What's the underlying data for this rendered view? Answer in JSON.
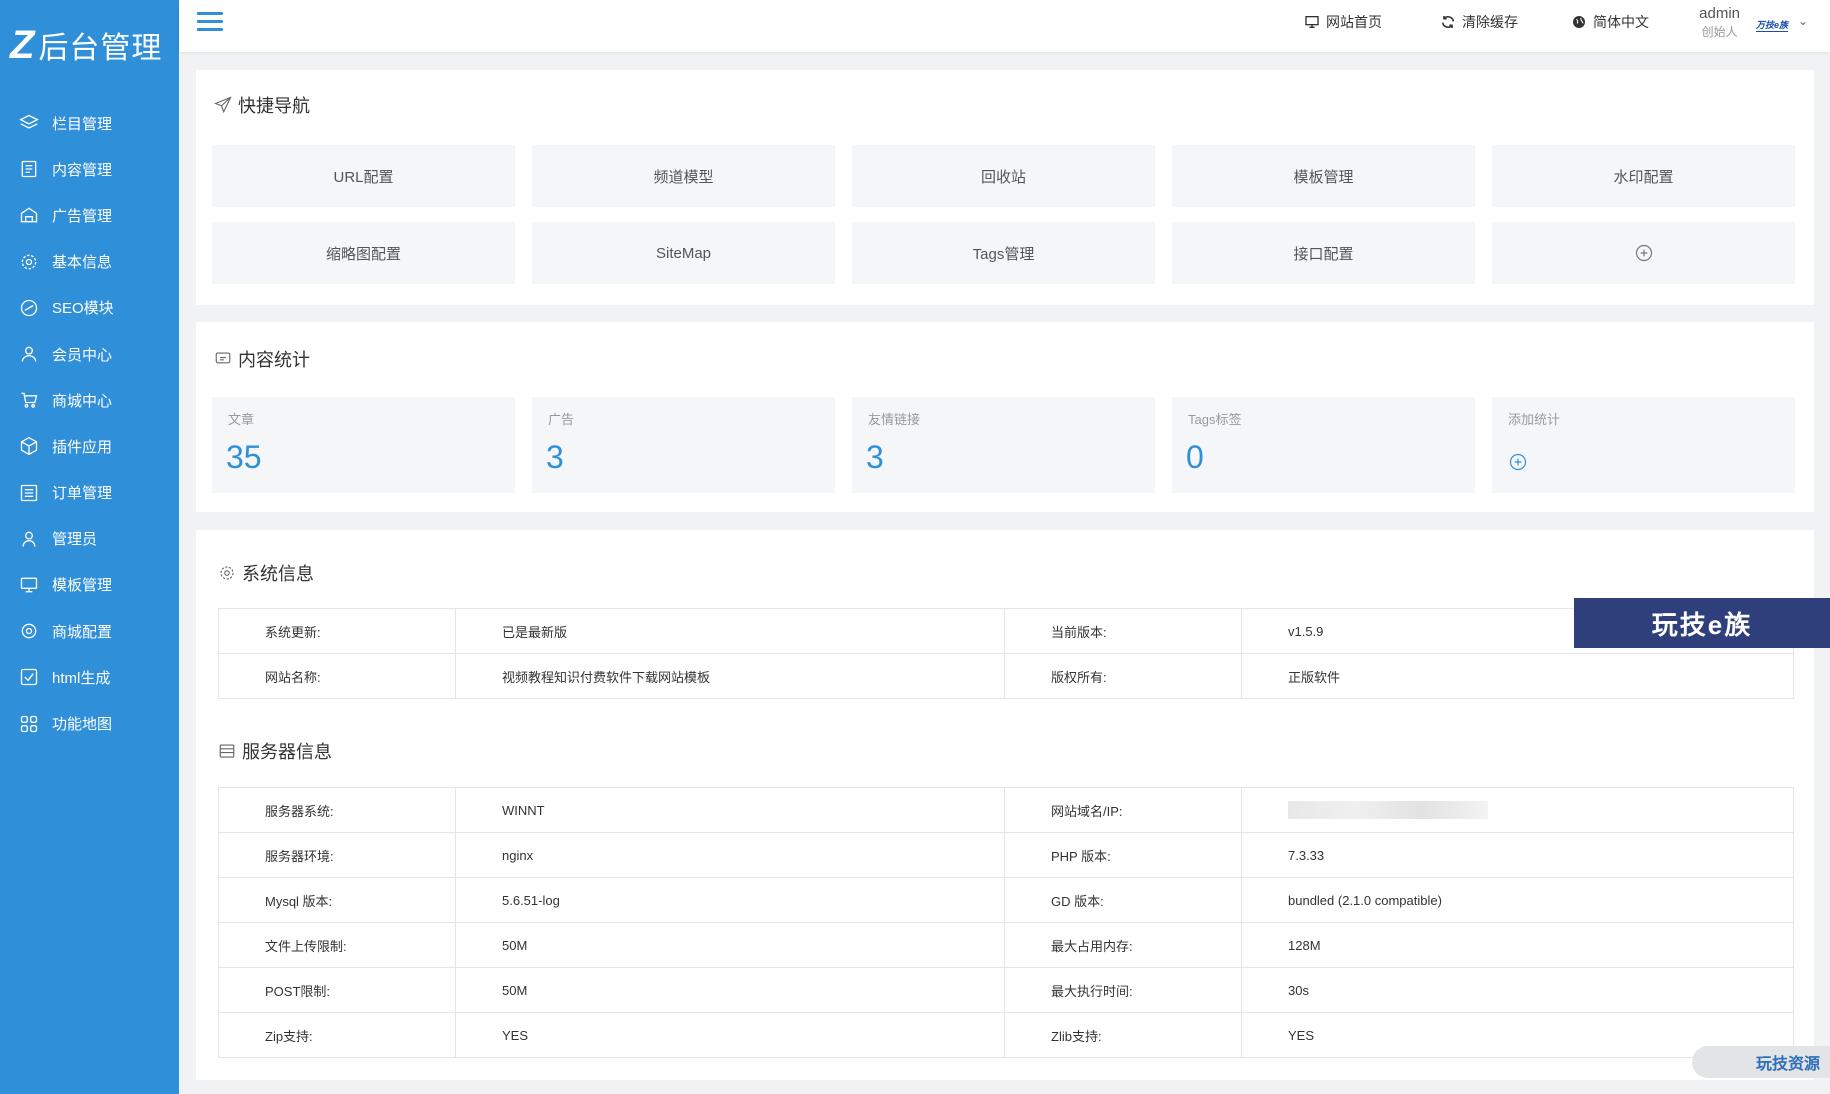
{
  "app": {
    "logo_mark": "Z",
    "logo_text": "后台管理"
  },
  "sidebar": {
    "items": [
      {
        "label": "栏目管理",
        "icon": "layers-icon"
      },
      {
        "label": "内容管理",
        "icon": "document-icon"
      },
      {
        "label": "广告管理",
        "icon": "ad-icon"
      },
      {
        "label": "基本信息",
        "icon": "gear-icon"
      },
      {
        "label": "SEO模块",
        "icon": "seo-icon"
      },
      {
        "label": "会员中心",
        "icon": "user-icon"
      },
      {
        "label": "商城中心",
        "icon": "cart-icon"
      },
      {
        "label": "插件应用",
        "icon": "cube-icon"
      },
      {
        "label": "订单管理",
        "icon": "list-icon"
      },
      {
        "label": "管理员",
        "icon": "admin-icon"
      },
      {
        "label": "模板管理",
        "icon": "monitor-icon"
      },
      {
        "label": "商城配置",
        "icon": "settings-icon"
      },
      {
        "label": "html生成",
        "icon": "check-square-icon"
      },
      {
        "label": "功能地图",
        "icon": "grid-icon"
      }
    ]
  },
  "header": {
    "site_home": "网站首页",
    "clear_cache": "清除缓存",
    "language": "简体中文",
    "user_name": "admin",
    "user_role": "创始人",
    "avatar_text": "万技e族"
  },
  "quick_nav": {
    "title": "快捷导航",
    "tiles": [
      "URL配置",
      "频道模型",
      "回收站",
      "模板管理",
      "水印配置",
      "缩略图配置",
      "SiteMap",
      "Tags管理",
      "接口配置"
    ]
  },
  "content_stats": {
    "title": "内容统计",
    "items": [
      {
        "label": "文章",
        "value": "35"
      },
      {
        "label": "广告",
        "value": "3"
      },
      {
        "label": "友情链接",
        "value": "3"
      },
      {
        "label": "Tags标签",
        "value": "0"
      }
    ],
    "add_label": "添加统计"
  },
  "system_info": {
    "title": "系统信息",
    "rows": [
      {
        "k1": "系统更新:",
        "v1": "已是最新版",
        "k2": "当前版本:",
        "v2": "v1.5.9"
      },
      {
        "k1": "网站名称:",
        "v1": "视频教程知识付费软件下载网站模板",
        "k2": "版权所有:",
        "v2": "正版软件"
      }
    ]
  },
  "server_info": {
    "title": "服务器信息",
    "rows": [
      {
        "k1": "服务器系统:",
        "v1": "WINNT",
        "k2": "网站域名/IP:",
        "v2": ""
      },
      {
        "k1": "服务器环境:",
        "v1": "nginx",
        "k2": "PHP 版本:",
        "v2": "7.3.33"
      },
      {
        "k1": "Mysql 版本:",
        "v1": "5.6.51-log",
        "k2": "GD 版本:",
        "v2": "bundled (2.1.0 compatible)"
      },
      {
        "k1": "文件上传限制:",
        "v1": "50M",
        "k2": "最大占用内存:",
        "v2": "128M"
      },
      {
        "k1": "POST限制:",
        "v1": "50M",
        "k2": "最大执行时间:",
        "v2": "30s"
      },
      {
        "k1": "Zip支持:",
        "v1": "YES",
        "k2": "Zlib支持:",
        "v2": "YES"
      }
    ]
  },
  "watermarks": {
    "banner": "玩技e族",
    "badge": "玩技资源"
  },
  "colors": {
    "sidebar": "#2f8fd8",
    "accent": "#2f8fd8"
  }
}
